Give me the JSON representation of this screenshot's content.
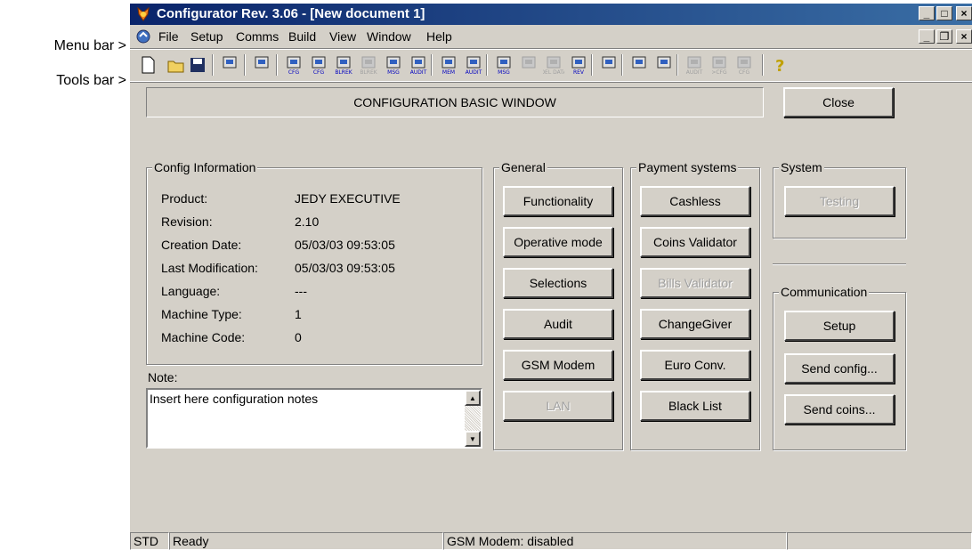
{
  "annotations": {
    "menu_bar": "Menu bar >",
    "tools_bar": "Tools bar >"
  },
  "window": {
    "title": "Configurator Rev. 3.06 - [New document 1]",
    "caption_buttons": [
      "minimize",
      "maximize",
      "close"
    ]
  },
  "menu": [
    "File",
    "Setup",
    "Comms",
    "Build",
    "View",
    "Window",
    "Help"
  ],
  "toolbar": {
    "icons": [
      {
        "name": "new-document-icon"
      },
      {
        "name": "open-folder-icon"
      },
      {
        "name": "save-icon"
      },
      {
        "name": "properties-icon"
      },
      {
        "name": "computer-icon"
      },
      {
        "name": "new-cfg-icon",
        "label": "CFG"
      },
      {
        "name": "open-cfg-icon",
        "label": "CFG"
      },
      {
        "name": "new-blrek-icon",
        "label": "BLREK"
      },
      {
        "name": "open-blrek-icon",
        "label": "BLREK"
      },
      {
        "name": "new-msg-icon",
        "label": "MSG"
      },
      {
        "name": "open-audit-icon",
        "label": "AUDIT"
      },
      {
        "name": "mem-icon",
        "label": "MEM"
      },
      {
        "name": "audit-icon",
        "label": "AUDIT"
      },
      {
        "name": "send-msg-icon",
        "label": "MSG"
      },
      {
        "name": "receive-icon"
      },
      {
        "name": "delete-data-icon",
        "label": "DEL DATA"
      },
      {
        "name": "rev-icon",
        "label": "REV"
      },
      {
        "name": "handheld-icon"
      },
      {
        "name": "book-icon"
      },
      {
        "name": "book-arrow-icon"
      },
      {
        "name": "audit-phone-icon",
        "label": "AUDIT"
      },
      {
        "name": "cfg-phone-icon",
        "label": ">CFG"
      },
      {
        "name": "cfg-phone2-icon",
        "label": "CFG"
      },
      {
        "name": "help-icon"
      }
    ]
  },
  "header": {
    "title": "CONFIGURATION BASIC WINDOW",
    "close_label": "Close"
  },
  "config_info": {
    "group_label": "Config Information",
    "rows": [
      {
        "label": "Product:",
        "value": "JEDY EXECUTIVE"
      },
      {
        "label": "Revision:",
        "value": "2.10"
      },
      {
        "label": "Creation Date:",
        "value": "05/03/03 09:53:05"
      },
      {
        "label": "Last Modification:",
        "value": "05/03/03 09:53:05"
      },
      {
        "label": "Language:",
        "value": "---"
      },
      {
        "label": "Machine Type:",
        "value": "1"
      },
      {
        "label": "Machine Code:",
        "value": "0"
      }
    ]
  },
  "note": {
    "label": "Note:",
    "value": "Insert here configuration notes"
  },
  "general": {
    "group_label": "General",
    "buttons": [
      "Functionality",
      "Operative mode",
      "Selections",
      "Audit",
      "GSM Modem",
      "LAN"
    ]
  },
  "payment": {
    "group_label": "Payment systems",
    "buttons": [
      "Cashless",
      "Coins Validator",
      "Bills Validator",
      "ChangeGiver",
      "Euro Conv.",
      "Black List"
    ]
  },
  "system": {
    "group_label": "System",
    "buttons": [
      "Testing"
    ]
  },
  "communication": {
    "group_label": "Communication",
    "buttons": [
      "Setup",
      "Send config...",
      "Send coins..."
    ]
  },
  "status": {
    "mode": "STD",
    "message": "Ready",
    "gsm": "GSM Modem: disabled"
  },
  "colors": {
    "titlebar_start": "#0a246a",
    "titlebar_end": "#3a6ea5",
    "face": "#d4d0c8"
  }
}
